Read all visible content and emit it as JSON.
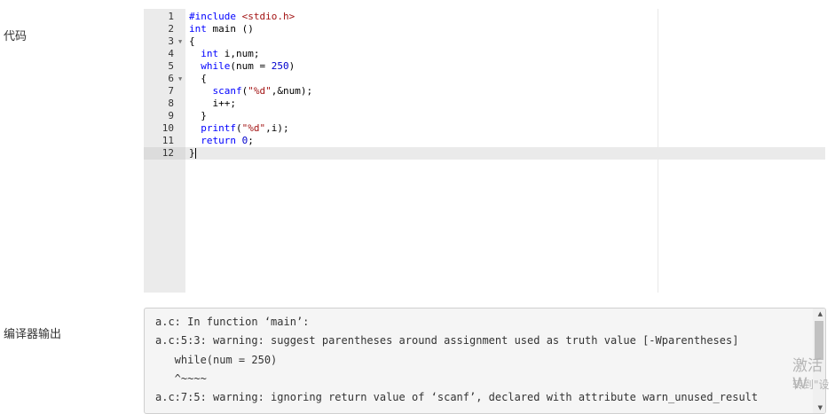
{
  "labels": {
    "code": "代码",
    "compiler_output": "编译器输出"
  },
  "editor": {
    "active_line": 12,
    "lines": [
      {
        "num": "1",
        "fold": false
      },
      {
        "num": "2",
        "fold": false
      },
      {
        "num": "3",
        "fold": true
      },
      {
        "num": "4",
        "fold": false
      },
      {
        "num": "5",
        "fold": false
      },
      {
        "num": "6",
        "fold": true
      },
      {
        "num": "7",
        "fold": false
      },
      {
        "num": "8",
        "fold": false
      },
      {
        "num": "9",
        "fold": false
      },
      {
        "num": "10",
        "fold": false
      },
      {
        "num": "11",
        "fold": false
      },
      {
        "num": "12",
        "fold": false
      }
    ],
    "tokens": [
      [
        {
          "t": "#include ",
          "c": "kw"
        },
        {
          "t": "<stdio.h>",
          "c": "inc"
        }
      ],
      [
        {
          "t": "int",
          "c": "kw"
        },
        {
          "t": " main ()",
          "c": ""
        }
      ],
      [
        {
          "t": "{",
          "c": ""
        }
      ],
      [
        {
          "t": "  ",
          "c": ""
        },
        {
          "t": "int",
          "c": "kw"
        },
        {
          "t": " i,num;",
          "c": ""
        }
      ],
      [
        {
          "t": "  ",
          "c": ""
        },
        {
          "t": "while",
          "c": "kw"
        },
        {
          "t": "(num = ",
          "c": ""
        },
        {
          "t": "250",
          "c": "numl"
        },
        {
          "t": ")",
          "c": ""
        }
      ],
      [
        {
          "t": "  {",
          "c": ""
        }
      ],
      [
        {
          "t": "    ",
          "c": ""
        },
        {
          "t": "scanf",
          "c": "kw"
        },
        {
          "t": "(",
          "c": ""
        },
        {
          "t": "\"%d\"",
          "c": "str"
        },
        {
          "t": ",&num);",
          "c": ""
        }
      ],
      [
        {
          "t": "    i++;",
          "c": ""
        }
      ],
      [
        {
          "t": "  }",
          "c": ""
        }
      ],
      [
        {
          "t": "  ",
          "c": ""
        },
        {
          "t": "printf",
          "c": "kw"
        },
        {
          "t": "(",
          "c": ""
        },
        {
          "t": "\"%d\"",
          "c": "str"
        },
        {
          "t": ",i);",
          "c": ""
        }
      ],
      [
        {
          "t": "  ",
          "c": ""
        },
        {
          "t": "return",
          "c": "kw"
        },
        {
          "t": " ",
          "c": ""
        },
        {
          "t": "0",
          "c": "numl"
        },
        {
          "t": ";",
          "c": ""
        }
      ],
      [
        {
          "t": "}",
          "c": ""
        }
      ]
    ],
    "fold_icon": "caret-down-icon"
  },
  "output": {
    "lines": [
      "a.c: In function ‘main’:",
      "a.c:5:3: warning: suggest parentheses around assignment used as truth value [-Wparentheses]",
      "   while(num = 250)",
      "   ^~~~~",
      "a.c:7:5: warning: ignoring return value of ‘scanf’, declared with attribute warn_unused_result"
    ]
  },
  "watermark": {
    "line1": "激活 W",
    "line2": "转到\"设"
  }
}
